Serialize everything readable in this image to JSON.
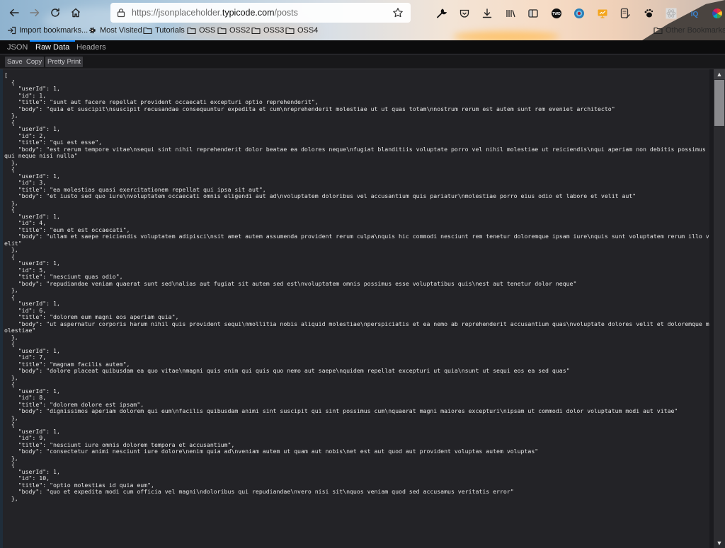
{
  "browser": {
    "url_prefix": "https://jsonplaceholder.",
    "url_host": "typicode.com",
    "url_path": "/posts",
    "nav": {
      "back": "back-icon",
      "forward": "forward-icon",
      "reload": "reload-icon",
      "home": "home-icon"
    },
    "toolbar_icons": [
      "wrench-icon",
      "pocket-icon",
      "download-icon",
      "library-icon",
      "sidebar-icon",
      "twd-extension-icon",
      "globe-extension-icon",
      "presentation-extension-icon",
      "notes-extension-icon",
      "paw-extension-icon",
      "react-extension-icon",
      "iq-extension-icon",
      "color-wheel-extension-icon",
      "menu-icon"
    ],
    "bookmarks": [
      {
        "label": "Import bookmarks...",
        "icon": "import-icon"
      },
      {
        "label": "Most Visited",
        "icon": "gear-icon"
      },
      {
        "label": "Tutorials",
        "icon": "folder-icon"
      },
      {
        "label": "OSS",
        "icon": "folder-icon"
      },
      {
        "label": "OSS2",
        "icon": "folder-icon"
      },
      {
        "label": "OSS3",
        "icon": "folder-icon"
      },
      {
        "label": "OSS4",
        "icon": "folder-icon"
      }
    ],
    "other_bookmarks": "Other Bookmarks"
  },
  "viewer": {
    "tabs": [
      {
        "label": "JSON",
        "active": false
      },
      {
        "label": "Raw Data",
        "active": true
      },
      {
        "label": "Headers",
        "active": false
      }
    ],
    "buttons": {
      "save": "Save",
      "copy": "Copy",
      "pretty_print": "Pretty Print"
    }
  },
  "posts": [
    {
      "userId": 1,
      "id": 1,
      "title": "sunt aut facere repellat provident occaecati excepturi optio reprehenderit",
      "body": "quia et suscipit\\nsuscipit recusandae consequuntur expedita et cum\\nreprehenderit molestiae ut ut quas totam\\nnostrum rerum est autem sunt rem eveniet architecto"
    },
    {
      "userId": 1,
      "id": 2,
      "title": "qui est esse",
      "body": "est rerum tempore vitae\\nsequi sint nihil reprehenderit dolor beatae ea dolores neque\\nfugiat blanditiis voluptate porro vel nihil molestiae ut reiciendis\\nqui aperiam non debitis possimus qui neque nisi nulla"
    },
    {
      "userId": 1,
      "id": 3,
      "title": "ea molestias quasi exercitationem repellat qui ipsa sit aut",
      "body": "et iusto sed quo iure\\nvoluptatem occaecati omnis eligendi aut ad\\nvoluptatem doloribus vel accusantium quis pariatur\\nmolestiae porro eius odio et labore et velit aut"
    },
    {
      "userId": 1,
      "id": 4,
      "title": "eum et est occaecati",
      "body": "ullam et saepe reiciendis voluptatem adipisci\\nsit amet autem assumenda provident rerum culpa\\nquis hic commodi nesciunt rem tenetur doloremque ipsam iure\\nquis sunt voluptatem rerum illo velit"
    },
    {
      "userId": 1,
      "id": 5,
      "title": "nesciunt quas odio",
      "body": "repudiandae veniam quaerat sunt sed\\nalias aut fugiat sit autem sed est\\nvoluptatem omnis possimus esse voluptatibus quis\\nest aut tenetur dolor neque"
    },
    {
      "userId": 1,
      "id": 6,
      "title": "dolorem eum magni eos aperiam quia",
      "body": "ut aspernatur corporis harum nihil quis provident sequi\\nmollitia nobis aliquid molestiae\\nperspiciatis et ea nemo ab reprehenderit accusantium quas\\nvoluptate dolores velit et doloremque molestiae"
    },
    {
      "userId": 1,
      "id": 7,
      "title": "magnam facilis autem",
      "body": "dolore placeat quibusdam ea quo vitae\\nmagni quis enim qui quis quo nemo aut saepe\\nquidem repellat excepturi ut quia\\nsunt ut sequi eos ea sed quas"
    },
    {
      "userId": 1,
      "id": 8,
      "title": "dolorem dolore est ipsam",
      "body": "dignissimos aperiam dolorem qui eum\\nfacilis quibusdam animi sint suscipit qui sint possimus cum\\nquaerat magni maiores excepturi\\nipsam ut commodi dolor voluptatum modi aut vitae"
    },
    {
      "userId": 1,
      "id": 9,
      "title": "nesciunt iure omnis dolorem tempora et accusantium",
      "body": "consectetur animi nesciunt iure dolore\\nenim quia ad\\nveniam autem ut quam aut nobis\\net est aut quod aut provident voluptas autem voluptas"
    },
    {
      "userId": 1,
      "id": 10,
      "title": "optio molestias id quia eum",
      "body": "quo et expedita modi cum officia vel magni\\ndoloribus qui repudiandae\\nvero nisi sit\\nquos veniam quod sed accusamus veritatis error"
    }
  ]
}
